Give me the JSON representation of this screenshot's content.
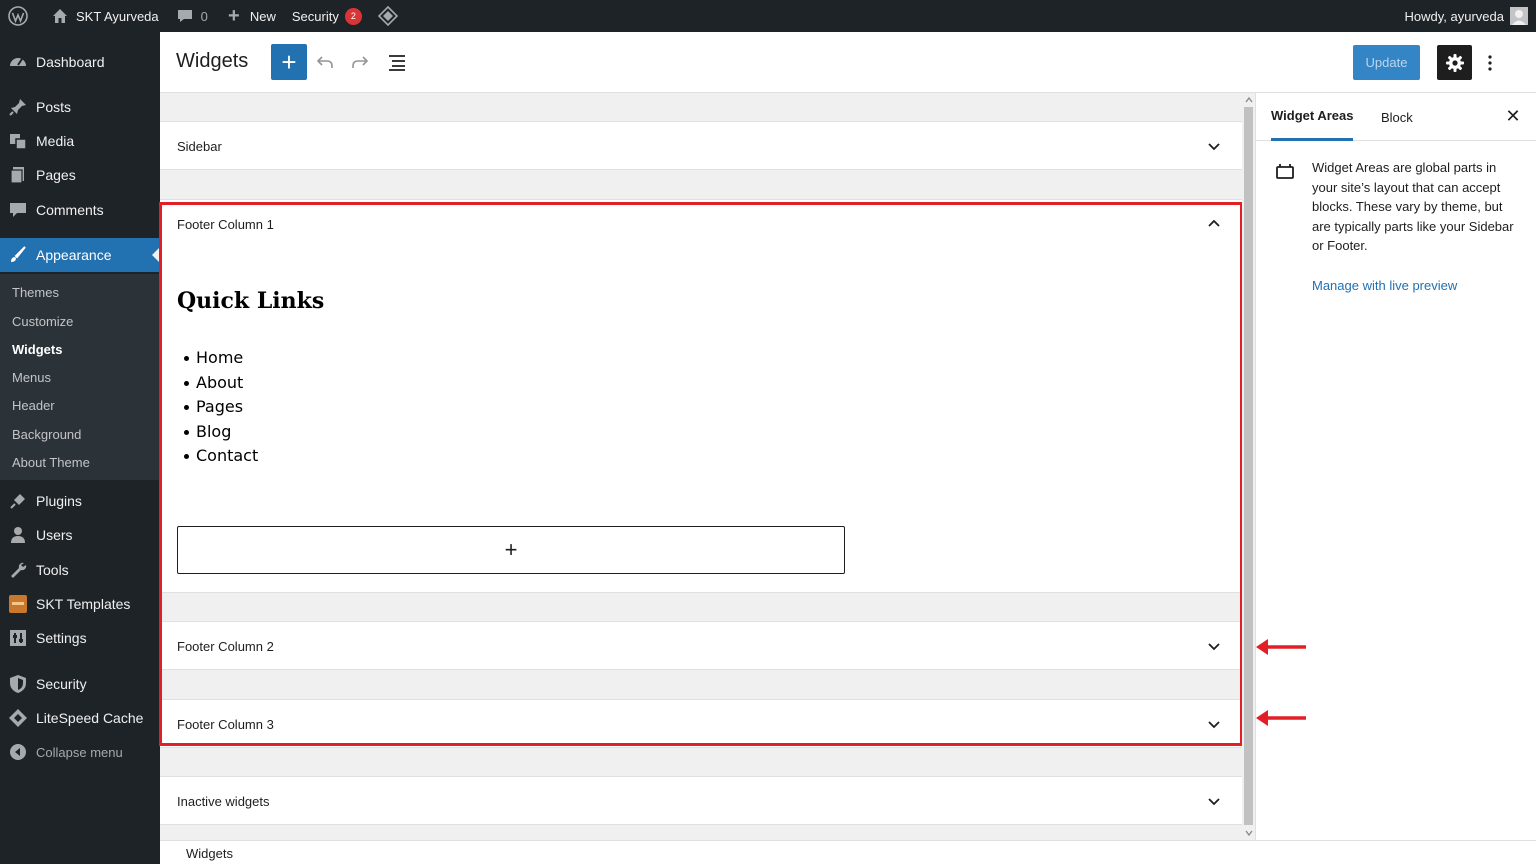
{
  "adminbar": {
    "site_name": "SKT Ayurveda",
    "comments_count": "0",
    "new_label": "New",
    "security_label": "Security",
    "security_badge": "2",
    "howdy": "Howdy, ayurveda"
  },
  "menu": {
    "dashboard": "Dashboard",
    "posts": "Posts",
    "media": "Media",
    "pages": "Pages",
    "comments": "Comments",
    "appearance": "Appearance",
    "submenu": [
      "Themes",
      "Customize",
      "Widgets",
      "Menus",
      "Header",
      "Background",
      "About Theme"
    ],
    "plugins": "Plugins",
    "users": "Users",
    "tools": "Tools",
    "skt_templates": "SKT Templates",
    "settings": "Settings",
    "security": "Security",
    "litespeed": "LiteSpeed Cache",
    "collapse": "Collapse menu"
  },
  "header": {
    "title": "Widgets",
    "inserter": "+",
    "update_label": "Update"
  },
  "areas": {
    "sidebar": "Sidebar",
    "footer1": "Footer Column 1",
    "footer2": "Footer Column 2",
    "footer3": "Footer Column 3",
    "inactive": "Inactive widgets"
  },
  "quick_links": {
    "heading": "Quick Links",
    "items": [
      "Home",
      "About",
      "Pages",
      "Blog",
      "Contact"
    ],
    "appender": "+"
  },
  "panel": {
    "tab_widget_areas": "Widget Areas",
    "tab_block": "Block",
    "close": "✕",
    "description": "Widget Areas are global parts in your site’s layout that can accept blocks. These vary by theme, but are typically parts like your Sidebar or Footer.",
    "link": "Manage with live preview"
  },
  "footer": {
    "breadcrumb": "Widgets"
  },
  "colors": {
    "accent": "#2271b1",
    "admin_dark": "#1d2327",
    "highlight_red": "#e21f26"
  }
}
